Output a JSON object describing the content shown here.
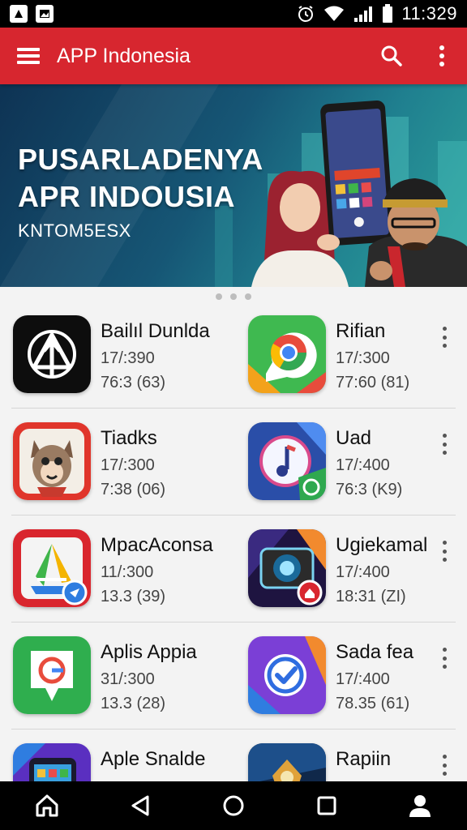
{
  "status_bar": {
    "time": "11:329"
  },
  "app_bar": {
    "title": "APP Indonesia"
  },
  "banner": {
    "headline_1": "PUSARLADENYA",
    "headline_2": "APR INDOUSIA",
    "subtext": "KNTOM5ESX"
  },
  "apps": [
    {
      "name": "Bailıl Dunlda",
      "line2": "17/:390",
      "line3": "76:3 (63)",
      "icon": "arrow-triangle-icon"
    },
    {
      "name": "Rifian",
      "line2": "17/:300",
      "line3": "77:60 (81)",
      "icon": "chrome-style-icon"
    },
    {
      "name": "Tiadks",
      "line2": "17/:300",
      "line3": "7:38 (06)",
      "icon": "cartoon-cat-icon"
    },
    {
      "name": "Uad",
      "line2": "17/:400",
      "line3": "76:3 (K9)",
      "icon": "music-note-icon"
    },
    {
      "name": "MpacAconsa",
      "line2": "11/:300",
      "line3": "13.3 (39)",
      "icon": "drive-triangle-icon"
    },
    {
      "name": "Ugiekamal",
      "line2": "17/:400",
      "line3": "18:31 (ZI)",
      "icon": "camera-device-icon"
    },
    {
      "name": "Aplis Appia",
      "line2": "31/:300",
      "line3": "13.3 (28)",
      "icon": "map-pin-icon"
    },
    {
      "name": "Sada fea",
      "line2": "17/:400",
      "line3": "78.35 (61)",
      "icon": "check-badge-icon"
    },
    {
      "name": "Aple Snalde",
      "line2": "",
      "line3": "",
      "icon": "phone-app-icon"
    },
    {
      "name": "Rapiin",
      "line2": "",
      "line3": "",
      "icon": "game-art-icon"
    }
  ],
  "colors": {
    "app_bar": "#d7262f",
    "status_bar": "#000000",
    "nav_bar": "#000000"
  }
}
